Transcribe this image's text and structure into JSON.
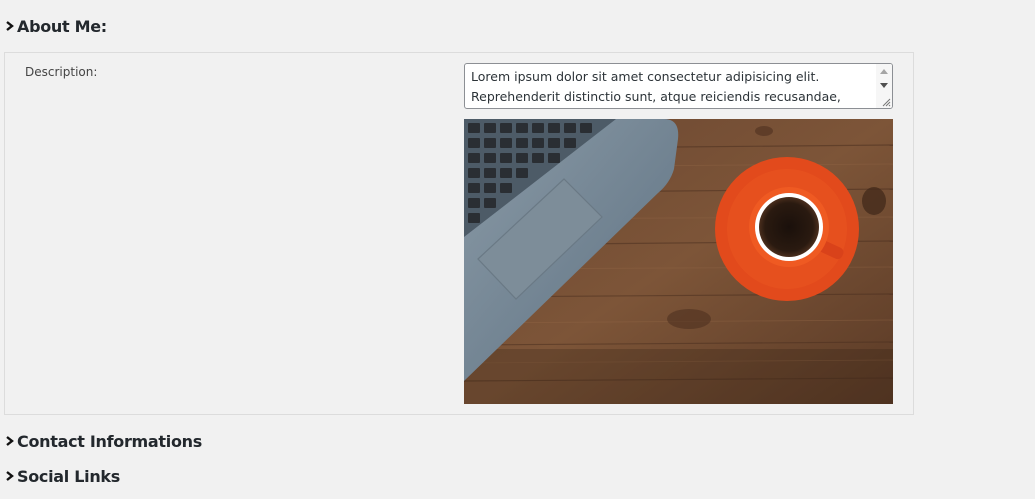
{
  "sections": {
    "about": {
      "title": "About Me:"
    },
    "contact": {
      "title": "Contact Informations"
    },
    "social": {
      "title": "Social Links"
    }
  },
  "about_panel": {
    "description_label": "Description:",
    "description_value": "Lorem ipsum dolor sit amet consectetur adipisicing elit.\nReprehenderit distinctio sunt, atque reiciendis recusandae,"
  },
  "icons": {
    "chevron": "chevron-right-icon",
    "scroll_up": "scroll-up-icon",
    "scroll_down": "scroll-down-icon",
    "resize": "resize-grip-icon"
  },
  "colors": {
    "background": "#f1f1f1",
    "panel_border": "#dcdcdc",
    "heading": "#23282d",
    "input_border": "#8c8f94"
  }
}
